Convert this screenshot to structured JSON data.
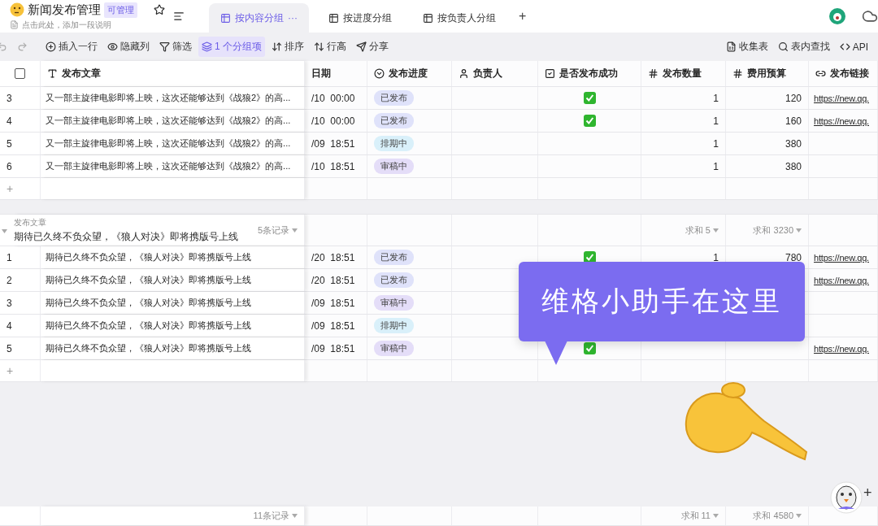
{
  "sheet": {
    "title": "新闻发布管理",
    "badge": "可管理",
    "description": "点击此处，添加一段说明"
  },
  "tabs": [
    {
      "label": "按内容分组",
      "selected": true,
      "more": "···"
    },
    {
      "label": "按进度分组",
      "selected": false
    },
    {
      "label": "按负责人分组",
      "selected": false
    }
  ],
  "tab_add": "+",
  "toolbar": [
    {
      "label": "插入一行",
      "kind": "insert",
      "active": false
    },
    {
      "label": "隐藏列",
      "kind": "hide",
      "active": false
    },
    {
      "label": "筛选",
      "kind": "filter",
      "active": false
    },
    {
      "label": "1 个分组项",
      "kind": "group",
      "active": true
    },
    {
      "label": "排序",
      "kind": "sort",
      "active": false
    },
    {
      "label": "行高",
      "kind": "height",
      "active": false
    },
    {
      "label": "分享",
      "kind": "share",
      "active": false
    }
  ],
  "toolbar_right": [
    {
      "label": "收集表",
      "kind": "form"
    },
    {
      "label": "表内查找",
      "kind": "search"
    },
    {
      "label": "API",
      "kind": "api"
    }
  ],
  "table": {
    "select_all": {
      "checked": false
    },
    "columns": [
      {
        "label": "发布文章",
        "kind": "text"
      },
      {
        "label": "日期",
        "kind": "date"
      },
      {
        "label": "发布进度",
        "kind": "select"
      },
      {
        "label": "负责人",
        "kind": "person"
      },
      {
        "label": "是否发布成功",
        "kind": "checkbox"
      },
      {
        "label": "发布数量",
        "kind": "number"
      },
      {
        "label": "费用预算",
        "kind": "number"
      },
      {
        "label": "发布链接",
        "kind": "link"
      }
    ],
    "groups": [
      {
        "rows": [
          {
            "no": "3",
            "title": "又一部主旋律电影即将上映，这次还能够达到《战狼2》的高...",
            "date": "/10  00:00",
            "progress": {
              "label": "已发布",
              "color": "#dfe2fa"
            },
            "success": true,
            "count": "1",
            "budget": "120",
            "link": "https://new.qq."
          },
          {
            "no": "4",
            "title": "又一部主旋律电影即将上映，这次还能够达到《战狼2》的高...",
            "date": "/10  00:00",
            "progress": {
              "label": "已发布",
              "color": "#dfe2fa"
            },
            "success": true,
            "count": "1",
            "budget": "160",
            "link": "https://new.qq."
          },
          {
            "no": "5",
            "title": "又一部主旋律电影即将上映，这次还能够达到《战狼2》的高...",
            "date": "/09  18:51",
            "progress": {
              "label": "排期中",
              "color": "#d9f0fa"
            },
            "success": false,
            "count": "1",
            "budget": "380"
          },
          {
            "no": "6",
            "title": "又一部主旋律电影即将上映，这次还能够达到《战狼2》的高...",
            "date": "/10  18:51",
            "progress": {
              "label": "审稿中",
              "color": "#e4ddf8"
            },
            "success": false,
            "count": "1",
            "budget": "380"
          }
        ],
        "add": "+"
      },
      {
        "header": {
          "field": "发布文章",
          "value": "期待已久终不负众望，《狼人对决》即将携版号上线",
          "records": "5条记录",
          "expanded": true,
          "sum_count": "求和 5",
          "sum_budget": "求和 3230"
        },
        "rows": [
          {
            "no": "1",
            "title": "期待已久终不负众望，《狼人对决》即将携版号上线",
            "date": "/20  18:51",
            "progress": {
              "label": "已发布",
              "color": "#dfe2fa"
            },
            "success": true,
            "count": "1",
            "budget": "780",
            "link": "https://new.qq."
          },
          {
            "no": "2",
            "title": "期待已久终不负众望，《狼人对决》即将携版号上线",
            "date": "/20  18:51",
            "progress": {
              "label": "已发布",
              "color": "#dfe2fa"
            },
            "link": "https://new.qq."
          },
          {
            "no": "3",
            "title": "期待已久终不负众望，《狼人对决》即将携版号上线",
            "date": "/09  18:51",
            "progress": {
              "label": "审稿中",
              "color": "#e4ddf8"
            }
          },
          {
            "no": "4",
            "title": "期待已久终不负众望，《狼人对决》即将携版号上线",
            "date": "/09  18:51",
            "progress": {
              "label": "排期中",
              "color": "#d9f0fa"
            }
          },
          {
            "no": "5",
            "title": "期待已久终不负众望，《狼人对决》即将携版号上线",
            "date": "/09  18:51",
            "progress": {
              "label": "审稿中",
              "color": "#e4ddf8"
            },
            "success": true,
            "link": "https://new.qq."
          }
        ],
        "add": "+"
      }
    ],
    "footer": {
      "records": "11条记录",
      "sum_count": "求和 11",
      "sum_budget": "求和 4580"
    }
  },
  "tooltip": {
    "text": "维格小助手在这里"
  },
  "float_add": "+"
}
